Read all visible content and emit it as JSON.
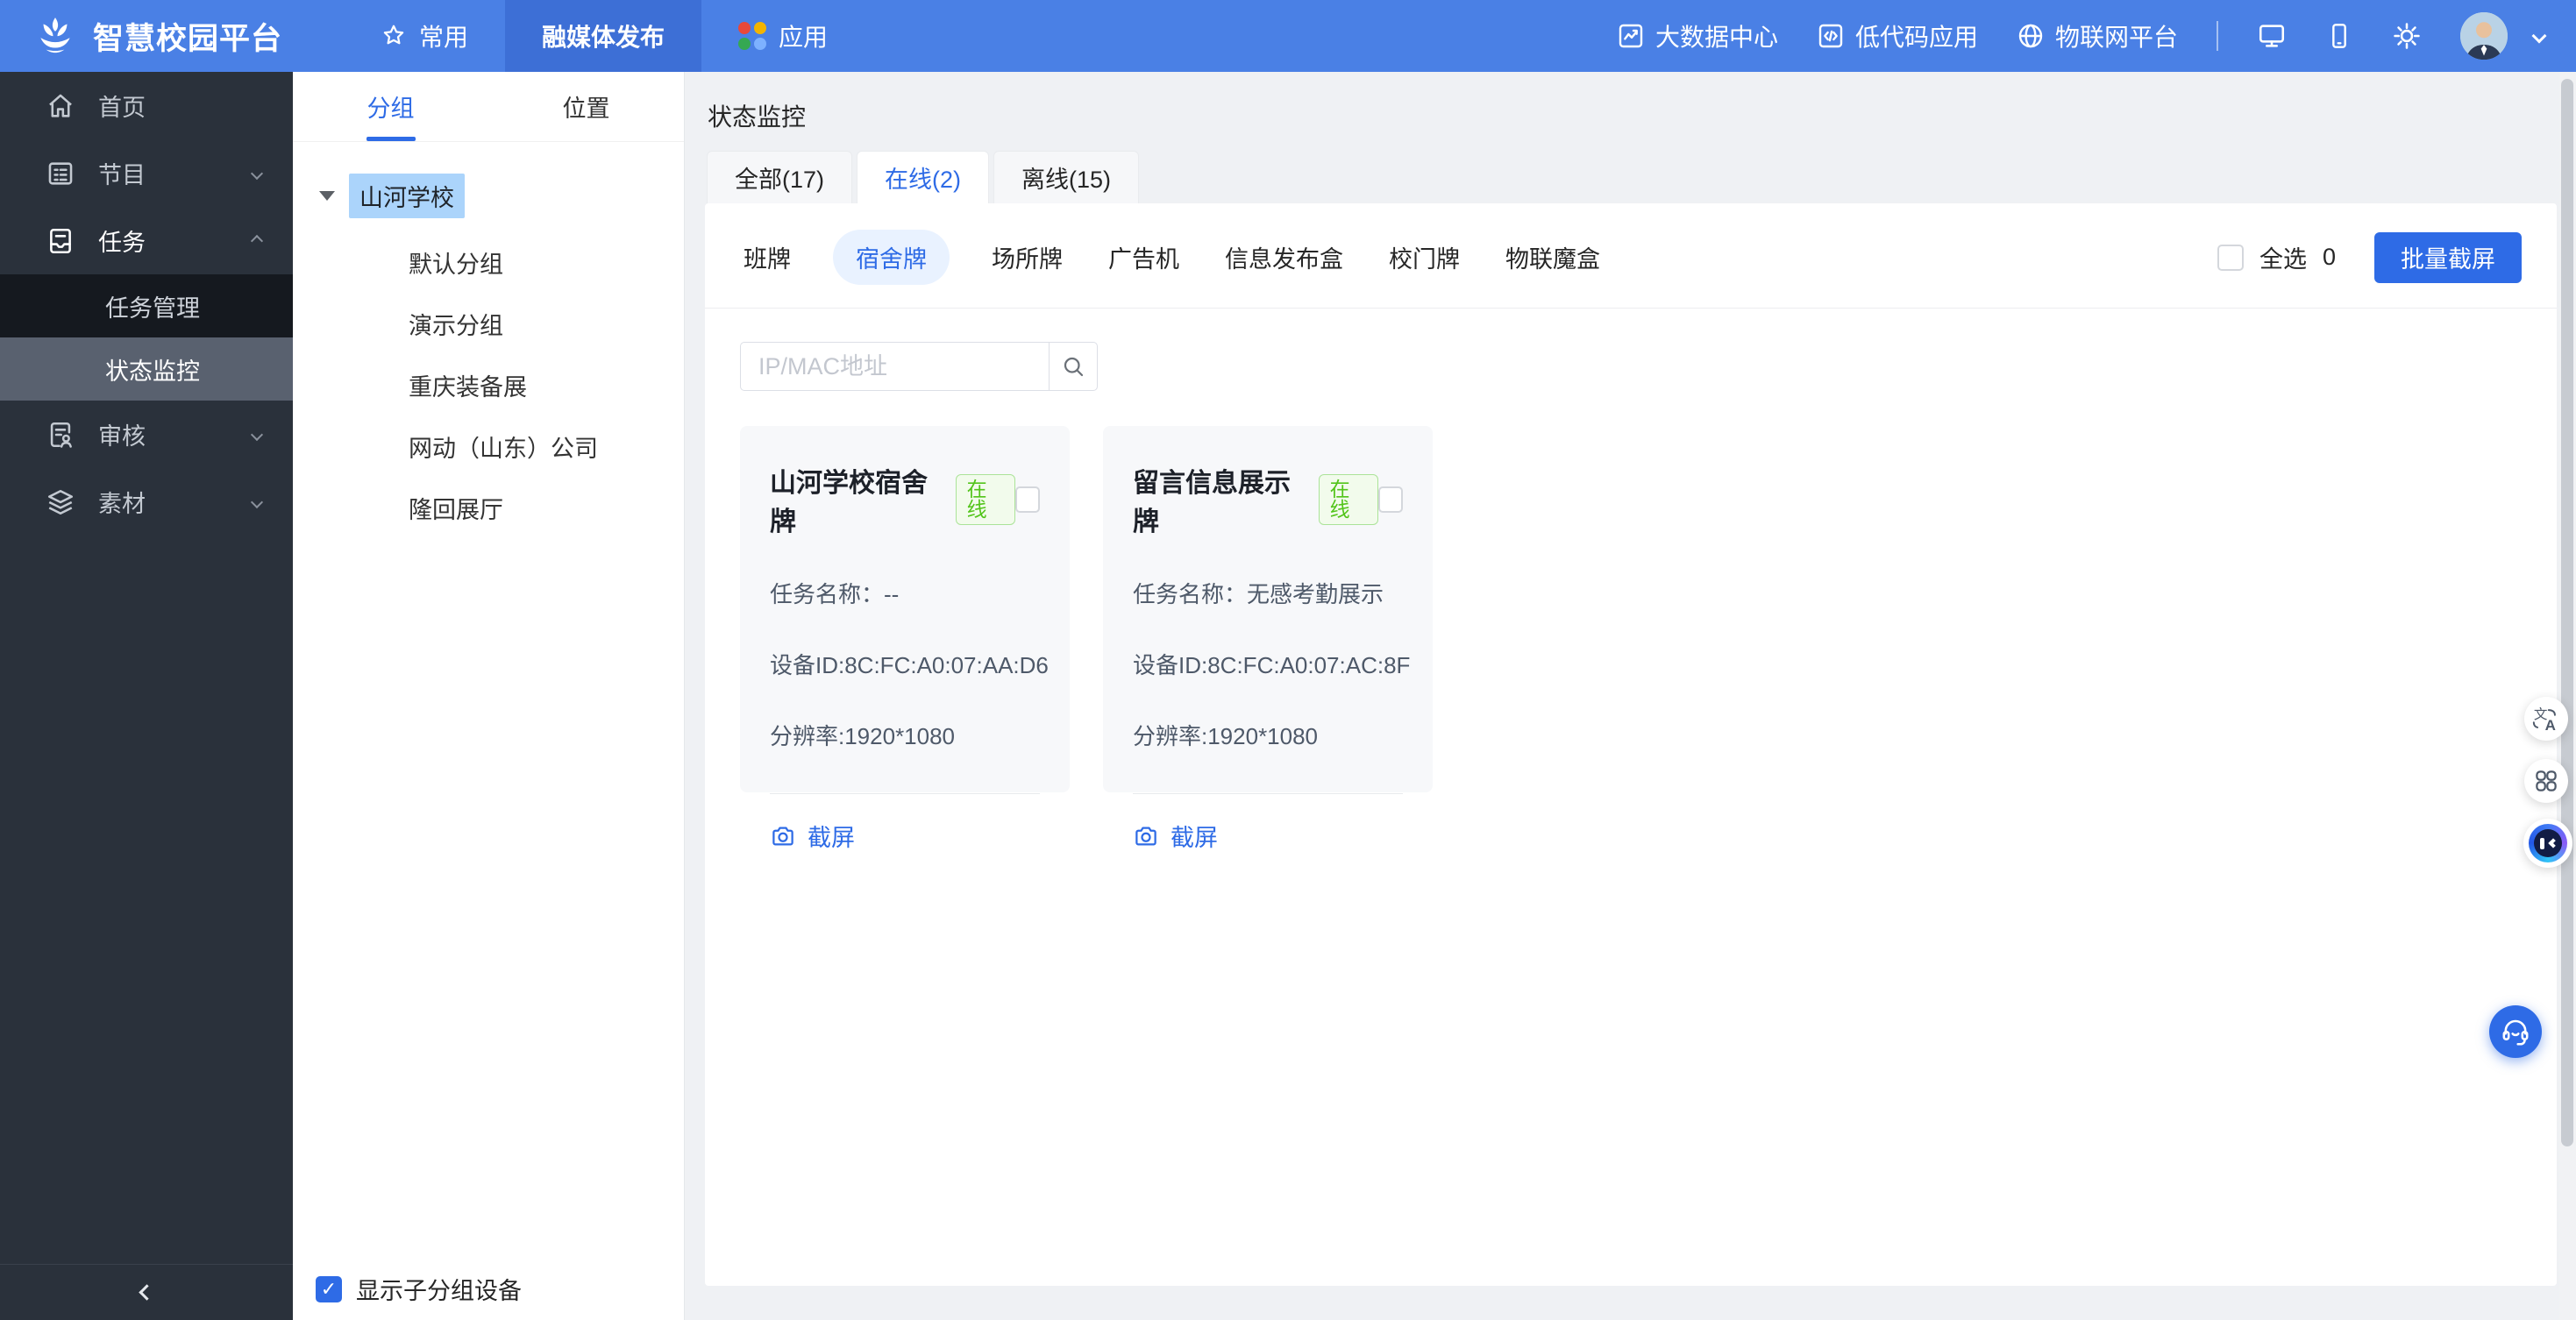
{
  "colors": {
    "navbar_blue": "#4a80e5",
    "navbar_active_blue": "#3d6fd6",
    "accent_blue": "#2e6be6",
    "sidebar_dark": "#2a313b",
    "submenu_selected_gray": "#59616f",
    "tree_highlight_blue": "#abd4fb",
    "badge_green": "#52c41a",
    "main_bg_gray": "#eff1f4"
  },
  "navbar": {
    "brand": "智慧校园平台",
    "menu": [
      "常用",
      "融媒体发布",
      "应用"
    ],
    "links": [
      "大数据中心",
      "低代码应用",
      "物联网平台"
    ]
  },
  "sidebar": {
    "items": [
      "首页",
      "节目",
      "任务",
      "审核",
      "素材"
    ],
    "submenu": [
      "任务管理",
      "状态监控"
    ]
  },
  "group_panel": {
    "tabs": [
      "分组",
      "位置"
    ],
    "root": "山河学校",
    "children": [
      "默认分组",
      "演示分组",
      "重庆装备展",
      "网动（山东）公司",
      "隆回展厅"
    ],
    "show_sub_label": "显示子分组设备"
  },
  "main": {
    "title": "状态监控",
    "status_tabs": [
      "全部(17)",
      "在线(2)",
      "离线(15)"
    ],
    "type_filters": [
      "班牌",
      "宿舍牌",
      "场所牌",
      "广告机",
      "信息发布盒",
      "校门牌",
      "物联魔盒"
    ],
    "select_all": "全选",
    "selected_count": "0",
    "batch_button": "批量截屏",
    "search_placeholder": "IP/MAC地址",
    "cards": [
      {
        "name": "山河学校宿舍牌",
        "status": "在线",
        "task": "任务名称：--",
        "device_id": "设备ID:8C:FC:A0:07:AA:D6",
        "resolution": "分辨率:1920*1080",
        "action": "截屏"
      },
      {
        "name": "留言信息展示牌",
        "status": "在线",
        "task": "任务名称：无感考勤展示",
        "device_id": "设备ID:8C:FC:A0:07:AC:8F",
        "resolution": "分辨率:1920*1080",
        "action": "截屏"
      }
    ]
  },
  "icons": {
    "check": "✓"
  }
}
